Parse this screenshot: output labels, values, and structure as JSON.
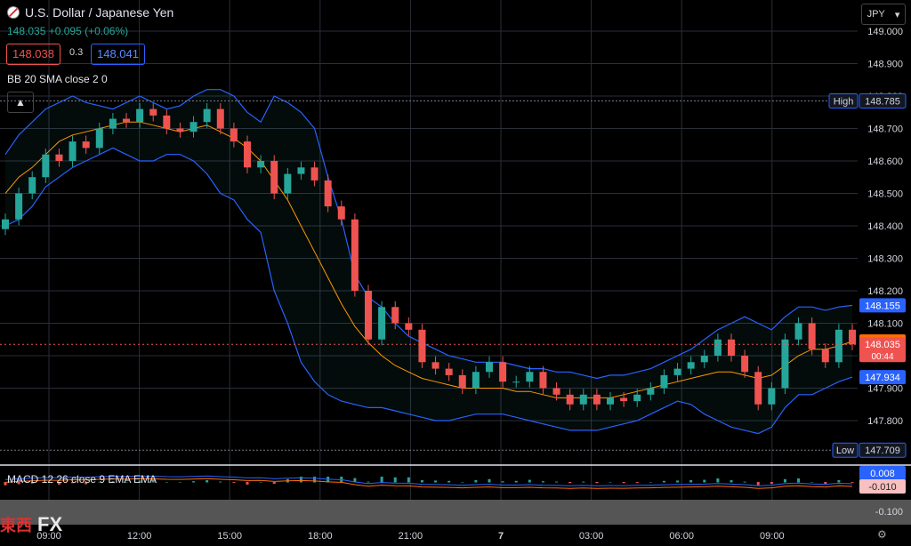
{
  "header": {
    "title": "U.S. Dollar / Japanese Yen",
    "change": "148.035 +0.095 (+0.06%)"
  },
  "quote": {
    "bid": "148.038",
    "spread": "0.3",
    "ask": "148.041"
  },
  "indicator_bb": "BB 20 SMA close 2 0",
  "indicator_macd": "MACD 12 26 close 9 EMA EMA",
  "currency_select": "JPY",
  "watermark": {
    "kanji": "東西",
    "text": "FX"
  },
  "colors": {
    "up": "#26a69a",
    "down": "#ef5350",
    "bb": "#2962ff",
    "basis": "#ff9800",
    "macd": "#2962ff",
    "signal": "#ff6d00"
  },
  "chart_data": {
    "type": "candlestick",
    "y_ticks": [
      "149.000",
      "148.900",
      "148.800",
      "148.700",
      "148.600",
      "148.500",
      "148.400",
      "148.300",
      "148.200",
      "148.100",
      "148.000",
      "147.900",
      "147.800"
    ],
    "x_ticks": [
      "09:00",
      "12:00",
      "15:00",
      "18:00",
      "21:00",
      "7",
      "03:00",
      "06:00",
      "09:00"
    ],
    "high_label": "High",
    "high": "148.785",
    "low_label": "Low",
    "low": "147.709",
    "price_badges": {
      "bb_upper": "148.155",
      "bb_basis": "148.044",
      "last": "148.035",
      "countdown": "00:44",
      "bb_lower": "147.934"
    },
    "macd_badges": {
      "macd": "0.008",
      "signal": "-0.010"
    },
    "macd_tick": "-0.100",
    "closes": [
      148.42,
      148.5,
      148.55,
      148.62,
      148.6,
      148.66,
      148.64,
      148.7,
      148.73,
      148.72,
      148.76,
      148.74,
      148.7,
      148.69,
      148.72,
      148.76,
      148.7,
      148.66,
      148.58,
      148.6,
      148.5,
      148.56,
      148.58,
      148.54,
      148.46,
      148.42,
      148.2,
      148.05,
      148.15,
      148.1,
      148.08,
      147.98,
      147.96,
      147.94,
      147.9,
      147.95,
      147.98,
      147.92,
      147.92,
      147.95,
      147.9,
      147.88,
      147.85,
      147.88,
      147.85,
      147.87,
      147.86,
      147.88,
      147.9,
      147.94,
      147.96,
      147.98,
      148.0,
      148.05,
      148.0,
      147.95,
      147.85,
      147.9,
      148.05,
      148.1,
      148.02,
      147.98,
      148.08,
      148.035
    ],
    "bb_upper": [
      148.62,
      148.68,
      148.72,
      148.76,
      148.78,
      148.8,
      148.78,
      148.77,
      148.76,
      148.78,
      148.8,
      148.78,
      148.76,
      148.77,
      148.8,
      148.82,
      148.82,
      148.8,
      148.75,
      148.72,
      148.8,
      148.78,
      148.75,
      148.7,
      148.55,
      148.42,
      148.25,
      148.18,
      148.15,
      148.1,
      148.06,
      148.04,
      148.02,
      148.0,
      147.99,
      147.98,
      147.98,
      147.98,
      147.97,
      147.96,
      147.96,
      147.95,
      147.95,
      147.94,
      147.93,
      147.94,
      147.94,
      147.95,
      147.96,
      147.98,
      148.0,
      148.02,
      148.05,
      148.08,
      148.1,
      148.12,
      148.1,
      148.08,
      148.12,
      148.15,
      148.15,
      148.14,
      148.15,
      148.155
    ],
    "bb_lower": [
      148.4,
      148.42,
      148.46,
      148.52,
      148.55,
      148.58,
      148.6,
      148.62,
      148.64,
      148.62,
      148.6,
      148.6,
      148.62,
      148.62,
      148.6,
      148.56,
      148.5,
      148.48,
      148.42,
      148.38,
      148.2,
      148.1,
      147.98,
      147.92,
      147.88,
      147.86,
      147.85,
      147.84,
      147.84,
      147.83,
      147.82,
      147.81,
      147.8,
      147.8,
      147.81,
      147.82,
      147.82,
      147.82,
      147.81,
      147.8,
      147.79,
      147.78,
      147.77,
      147.77,
      147.77,
      147.78,
      147.79,
      147.8,
      147.82,
      147.84,
      147.86,
      147.85,
      147.82,
      147.8,
      147.78,
      147.77,
      147.76,
      147.78,
      147.84,
      147.88,
      147.88,
      147.9,
      147.92,
      147.934
    ],
    "bb_basis": [
      148.5,
      148.55,
      148.58,
      148.62,
      148.66,
      148.68,
      148.69,
      148.7,
      148.71,
      148.72,
      148.72,
      148.71,
      148.7,
      148.69,
      148.7,
      148.71,
      148.69,
      148.67,
      148.64,
      148.6,
      148.54,
      148.48,
      148.4,
      148.32,
      148.24,
      148.16,
      148.09,
      148.04,
      148.0,
      147.97,
      147.95,
      147.93,
      147.92,
      147.91,
      147.9,
      147.9,
      147.9,
      147.9,
      147.89,
      147.89,
      147.88,
      147.87,
      147.87,
      147.87,
      147.87,
      147.87,
      147.88,
      147.89,
      147.9,
      147.91,
      147.92,
      147.93,
      147.94,
      147.95,
      147.95,
      147.94,
      147.93,
      147.94,
      147.97,
      148.0,
      148.02,
      148.02,
      148.03,
      148.044
    ]
  }
}
